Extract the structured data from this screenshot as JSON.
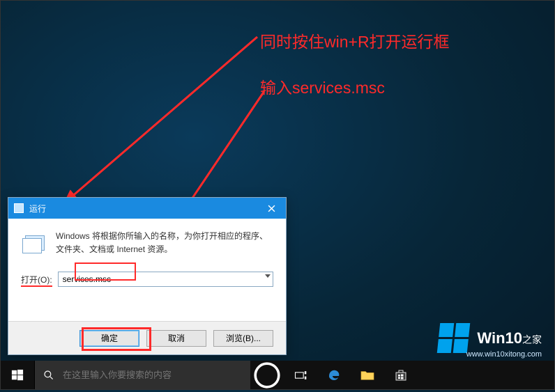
{
  "annotations": {
    "line1": "同时按住win+R打开运行框",
    "line2": "输入services.msc"
  },
  "run": {
    "title": "运行",
    "description": "Windows 将根据你所输入的名称，为你打开相应的程序、文件夹、文档或 Internet 资源。",
    "open_label": "打开(O):",
    "open_value": "services.msc",
    "ok": "确定",
    "cancel": "取消",
    "browse": "浏览(B)..."
  },
  "taskbar": {
    "search_placeholder": "在这里输入你要搜索的内容"
  },
  "watermark": {
    "brand_main": "Win10",
    "brand_sub": "之家",
    "url": "www.win10xitong.com"
  }
}
